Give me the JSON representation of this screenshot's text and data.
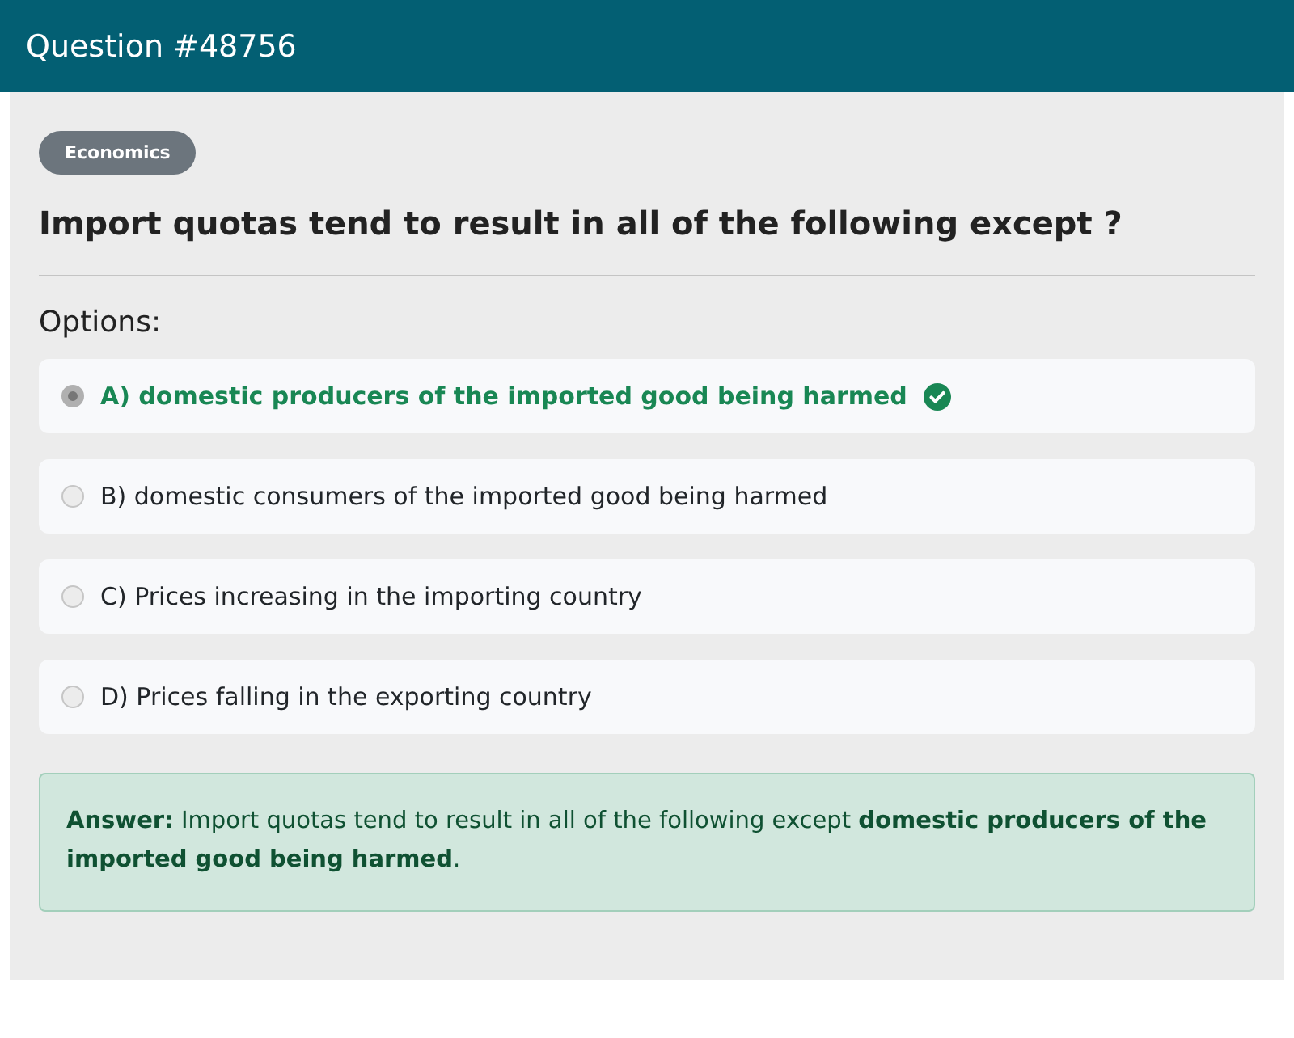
{
  "header": {
    "title": "Question #48756"
  },
  "category": "Economics",
  "question": "Import quotas tend to result in all of the following except ?",
  "options_label": "Options:",
  "options": [
    {
      "text": "A) domestic producers of the imported good being harmed",
      "selected": true,
      "correct": true
    },
    {
      "text": "B) domestic consumers of the imported good being harmed",
      "selected": false,
      "correct": false
    },
    {
      "text": "C) Prices increasing in the importing country",
      "selected": false,
      "correct": false
    },
    {
      "text": "D) Prices falling in the exporting country",
      "selected": false,
      "correct": false
    }
  ],
  "answer": "**Answer:** Import quotas tend to result in all of the following except **domestic producers of the imported good being harmed**."
}
